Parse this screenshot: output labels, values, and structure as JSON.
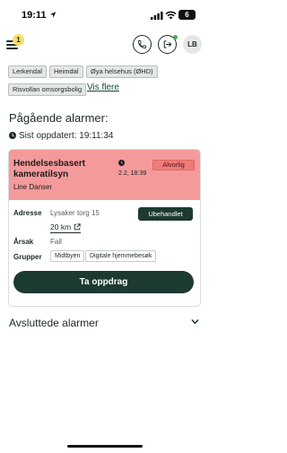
{
  "status_bar": {
    "time": "19:11",
    "battery": "6",
    "icons": [
      "location-arrow-icon",
      "signal-icon",
      "wifi-icon",
      "battery-icon"
    ]
  },
  "header": {
    "menu_badge": "1",
    "avatar_initials": "LB",
    "icons": [
      "menu-icon",
      "phone-icon",
      "logout-icon"
    ]
  },
  "filters": {
    "chips": [
      "Lerkendal",
      "Heimdal",
      "Øya helsehus (ØHD)",
      "Risvollan omsorgsbolig"
    ],
    "see_more": "Vis flere"
  },
  "ongoing": {
    "title": "Pågående alarmer:",
    "updated": "Sist oppdatert: 19:11:34"
  },
  "alarm": {
    "type": "Hendelsesbasert kameratilsyn",
    "person": "Line Danser",
    "time": "2.2, 18:39",
    "severity": "Alvorlig",
    "address_label": "Adresse",
    "address": "Lysaker torg 15",
    "distance": "20 km",
    "status": "Ubehandlet",
    "reason_label": "Årsak",
    "reason": "Fall",
    "groups_label": "Grupper",
    "groups": [
      "Midtbyen",
      "Digitale hjemmebesøk"
    ],
    "action": "Ta oppdrag"
  },
  "closed": {
    "title": "Avsluttede alarmer"
  },
  "colors": {
    "primary": "#1c3a31",
    "alarm_header": "#f59a9b",
    "severity": "#ee7b79",
    "badge": "#f5e06a",
    "online": "#38b24a"
  }
}
